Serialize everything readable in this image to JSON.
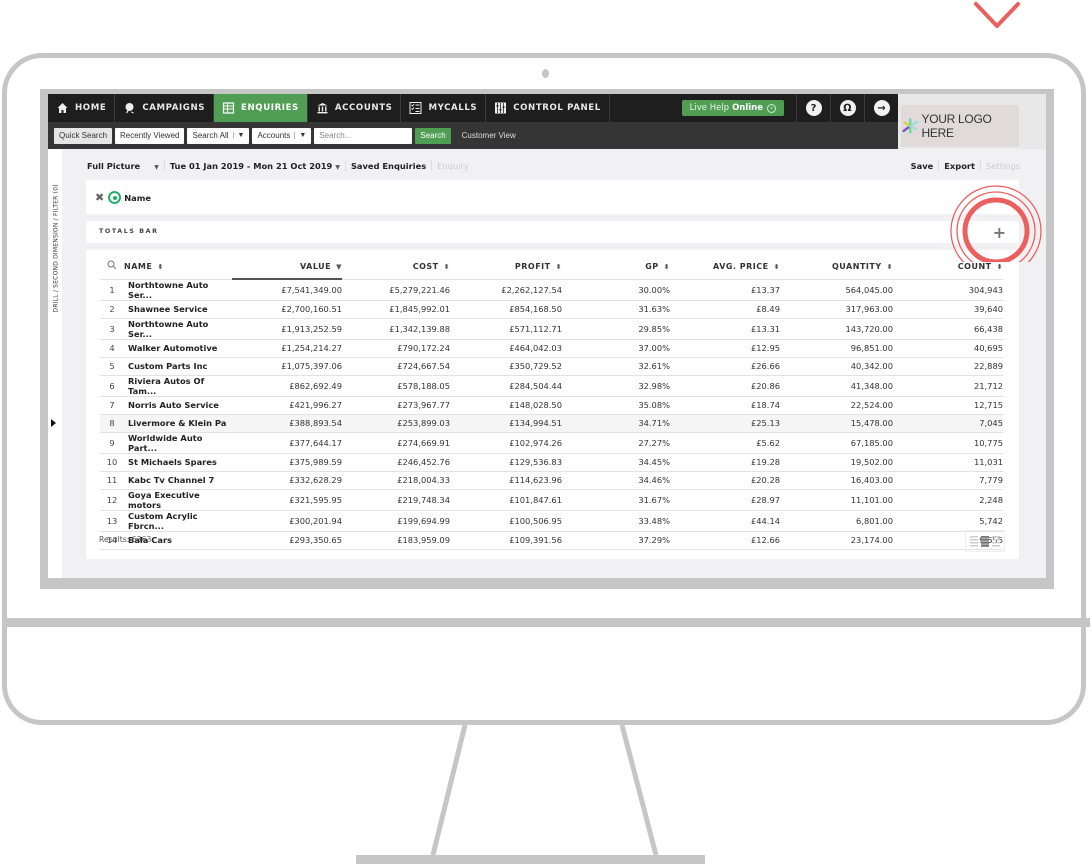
{
  "nav": {
    "items": [
      {
        "label": "HOME",
        "icon": "home-icon"
      },
      {
        "label": "CAMPAIGNS",
        "icon": "campaigns-icon"
      },
      {
        "label": "ENQUIRIES",
        "icon": "enquiries-icon",
        "active": true
      },
      {
        "label": "ACCOUNTS",
        "icon": "bank-icon"
      },
      {
        "label": "MYCALLS",
        "icon": "checklist-icon"
      },
      {
        "label": "CONTROL PANEL",
        "icon": "grid-icon"
      }
    ],
    "live_help_prefix": "Live Help",
    "live_help_status": "Online",
    "help_glyph": "?",
    "user_glyph": "Ω",
    "logout_glyph": "→"
  },
  "subnav": {
    "quick_search": "Quick Search",
    "recently_viewed": "Recently Viewed",
    "scope_select": "Search All",
    "type_select": "Accounts",
    "search_placeholder": "Search...",
    "search_button": "Search",
    "customer_view": "Customer View"
  },
  "logo_text": "YOUR LOGO HERE",
  "drill_label": "DRILL / SECOND DIMENSION / FILTER (0)",
  "toolbar": {
    "view": "Full Picture",
    "date_range": "Tue 01 Jan 2019 - Mon 21 Oct 2019",
    "saved_enquiries": "Saved Enquiries",
    "enquiry": "Enquiry",
    "save": "Save",
    "export": "Export",
    "settings": "Settings"
  },
  "dimension_chip": "Name",
  "totals_bar_label": "TOTALS BAR",
  "add_glyph": "+",
  "table": {
    "columns": [
      "NAME",
      "VALUE",
      "COST",
      "PROFIT",
      "GP",
      "AVG. PRICE",
      "QUANTITY",
      "COUNT"
    ],
    "sorted_column": "VALUE",
    "rows": [
      [
        "1",
        "Northtowne Auto Ser...",
        "£7,541,349.00",
        "£5,279,221.46",
        "£2,262,127.54",
        "30.00%",
        "£13.37",
        "564,045.00",
        "304,943"
      ],
      [
        "2",
        "Shawnee Service",
        "£2,700,160.51",
        "£1,845,992.01",
        "£854,168.50",
        "31.63%",
        "£8.49",
        "317,963.00",
        "39,640"
      ],
      [
        "3",
        "Northtowne Auto Ser...",
        "£1,913,252.59",
        "£1,342,139.88",
        "£571,112.71",
        "29.85%",
        "£13.31",
        "143,720.00",
        "66,438"
      ],
      [
        "4",
        "Walker Automotive",
        "£1,254,214.27",
        "£790,172.24",
        "£464,042.03",
        "37.00%",
        "£12.95",
        "96,851.00",
        "40,695"
      ],
      [
        "5",
        "Custom Parts Inc",
        "£1,075,397.06",
        "£724,667.54",
        "£350,729.52",
        "32.61%",
        "£26.66",
        "40,342.00",
        "22,889"
      ],
      [
        "6",
        "Riviera Autos Of Tam...",
        "£862,692.49",
        "£578,188.05",
        "£284,504.44",
        "32.98%",
        "£20.86",
        "41,348.00",
        "21,712"
      ],
      [
        "7",
        "Norris Auto Service",
        "£421,996.27",
        "£273,967.77",
        "£148,028.50",
        "35.08%",
        "£18.74",
        "22,524.00",
        "12,715"
      ],
      [
        "8",
        "Livermore & Klein Pa",
        "£388,893.54",
        "£253,899.03",
        "£134,994.51",
        "34.71%",
        "£25.13",
        "15,478.00",
        "7,045"
      ],
      [
        "9",
        "Worldwide Auto Part...",
        "£377,644.17",
        "£274,669.91",
        "£102,974.26",
        "27.27%",
        "£5.62",
        "67,185.00",
        "10,775"
      ],
      [
        "10",
        "St Michaels Spares",
        "£375,989.59",
        "£246,452.76",
        "£129,536.83",
        "34.45%",
        "£19.28",
        "19,502.00",
        "11,031"
      ],
      [
        "11",
        "Kabc Tv Channel 7",
        "£332,628.29",
        "£218,004.33",
        "£114,623.96",
        "34.46%",
        "£20.28",
        "16,403.00",
        "7,779"
      ],
      [
        "12",
        "Goya Executive motors",
        "£321,595.95",
        "£219,748.34",
        "£101,847.61",
        "31.67%",
        "£28.97",
        "11,101.00",
        "2,248"
      ],
      [
        "13",
        "Custom Acrylic Fbrcn...",
        "£300,201.94",
        "£199,694.99",
        "£100,506.95",
        "33.48%",
        "£44.14",
        "6,801.00",
        "5,742"
      ],
      [
        "14",
        "Bala Cars",
        "£293,350.65",
        "£183,959.09",
        "£109,391.56",
        "37.29%",
        "£12.66",
        "23,174.00",
        "9,655"
      ]
    ],
    "highlighted_row": 8
  },
  "results_label": "Results: 6363",
  "colors": {
    "accent_green": "#4f9e53",
    "nav_dark": "#1e1e1e",
    "highlight_red": "#ec5f5f",
    "frame_grey": "#c6c6c6"
  }
}
